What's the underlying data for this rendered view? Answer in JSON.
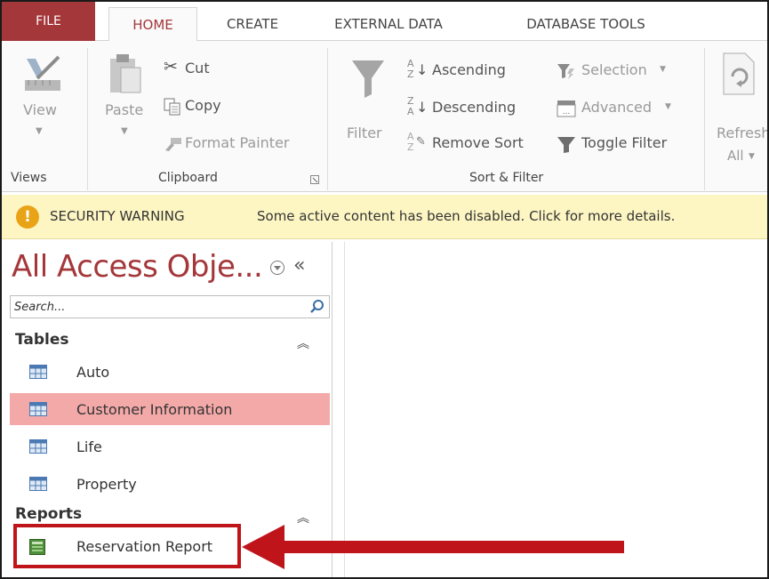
{
  "tabs": {
    "file": "FILE",
    "home": "HOME",
    "create": "CREATE",
    "external": "EXTERNAL DATA",
    "dbtools": "DATABASE TOOLS"
  },
  "ribbon": {
    "views": {
      "label": "Views",
      "view_button": "View"
    },
    "clipboard": {
      "label": "Clipboard",
      "paste": "Paste",
      "cut": "Cut",
      "copy": "Copy",
      "format_painter": "Format Painter"
    },
    "sort_filter": {
      "label": "Sort & Filter",
      "filter": "Filter",
      "ascending": "Ascending",
      "descending": "Descending",
      "remove_sort": "Remove Sort",
      "selection": "Selection",
      "advanced": "Advanced",
      "toggle_filter": "Toggle Filter"
    },
    "records": {
      "refresh_line1": "Refresh",
      "refresh_line2": "All"
    }
  },
  "security": {
    "title": "SECURITY WARNING",
    "message": "Some active content has been disabled. Click for more details."
  },
  "nav": {
    "title": "All Access Obje...",
    "search_placeholder": "Search...",
    "sections": [
      {
        "header": "Tables",
        "items": [
          "Auto",
          "Customer Information",
          "Life",
          "Property"
        ]
      },
      {
        "header": "Reports",
        "items": [
          "Reservation Report"
        ]
      }
    ],
    "selected_item": "Customer Information"
  },
  "colors": {
    "accent": "#a4373a",
    "selection": "#f4a9a9",
    "warning_bar": "#fdf6c3",
    "callout": "#c0141b"
  }
}
